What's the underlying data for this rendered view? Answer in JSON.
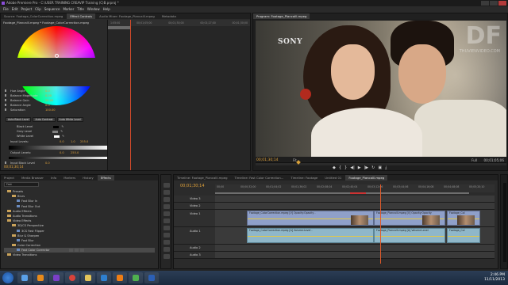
{
  "window": {
    "title": "Adobe Premiere Pro - C:\\USER TRAINING CREAVIP Training (C)B.prproj *"
  },
  "menu": [
    "File",
    "Edit",
    "Project",
    "Clip",
    "Sequence",
    "Marker",
    "Title",
    "Window",
    "Help"
  ],
  "effect_controls": {
    "tabs": [
      "Source: Footage_ColorCorrection.mpeg",
      "Effect Controls",
      "Audio Mixer: Footage_Plancalll.mpeg",
      "Metadata"
    ],
    "clip_path": "Footage_Plancalll.mpeg * Footage_ColorCorrection.mpeg",
    "ruler": [
      "1:05:00",
      "00;01;05;00",
      "00;01;30;00",
      "00;01;27;00",
      "00;01;30;00"
    ],
    "properties": [
      {
        "label": "Hue Angle",
        "value": "0.0"
      },
      {
        "label": "Balance Magnitude",
        "value": "0.00"
      },
      {
        "label": "Balance Gain",
        "value": "20.00"
      },
      {
        "label": "Balance Angle",
        "value": "0.0"
      },
      {
        "label": "Saturation",
        "value": "100.00"
      }
    ],
    "auto_buttons": [
      "Auto Black Level",
      "Auto Contrast",
      "Auto White Level"
    ],
    "levels": [
      "Black Level",
      "Gray Level",
      "White Level"
    ],
    "input_levels_label": "Input Levels:",
    "input_levels_values": [
      "0.0",
      "1.0",
      "255.0"
    ],
    "output_levels_label": "Output Levels:",
    "output_levels_values": [
      "0.0",
      "255.0"
    ],
    "more_props": [
      {
        "label": "Input Black Level",
        "value": "0.0"
      },
      {
        "label": "Input Gray Level",
        "value": "1.00"
      },
      {
        "label": "Input White Level",
        "value": "255.00"
      },
      {
        "label": "Output Black Level",
        "value": "0.00"
      }
    ],
    "timecode": "00;01;30;14"
  },
  "program_monitor": {
    "tab": "Program: Footage_Plancalll.mpeg",
    "brand": "SONY",
    "watermark": "DF",
    "watermark_sub": "THUVIENVIDEO.COM",
    "timecode": "00;01;30;14",
    "fit": "Fit",
    "full": "Full",
    "duration": "00;01;05;06",
    "transport_icons": [
      "marker-icon",
      "in-icon",
      "out-icon",
      "step-back-icon",
      "play-icon",
      "step-forward-icon",
      "loop-icon",
      "safe-icon",
      "export-icon"
    ]
  },
  "effects_panel": {
    "tabs": [
      "Project",
      "Media Browser",
      "Info",
      "Markers",
      "History",
      "Effects"
    ],
    "search": "Fast",
    "items": [
      {
        "label": "Presets",
        "kind": "folder",
        "indent": 0
      },
      {
        "label": "Blurs",
        "kind": "folder",
        "indent": 1
      },
      {
        "label": "Fast Blur In",
        "kind": "effect",
        "indent": 2
      },
      {
        "label": "Fast Blur Out",
        "kind": "effect",
        "indent": 2
      },
      {
        "label": "Audio Effects",
        "kind": "folder",
        "indent": 0
      },
      {
        "label": "Audio Transitions",
        "kind": "folder",
        "indent": 0
      },
      {
        "label": "Video Effects",
        "kind": "folder",
        "indent": 0
      },
      {
        "label": "3D/CS Perspective",
        "kind": "folder",
        "indent": 1
      },
      {
        "label": "3CS Fast Flipper",
        "kind": "effect",
        "indent": 2
      },
      {
        "label": "Blur & Sharpen",
        "kind": "folder",
        "indent": 1
      },
      {
        "label": "Fast Blur",
        "kind": "effect",
        "indent": 2
      },
      {
        "label": "Color Correction",
        "kind": "folder",
        "indent": 1
      },
      {
        "label": "Fast Color Corrector",
        "kind": "effect",
        "indent": 2,
        "selected": true
      },
      {
        "label": "Video Transitions",
        "kind": "folder",
        "indent": 0
      }
    ]
  },
  "timeline": {
    "tabs": [
      "Timeline: Footage_Plancalll.mpeg",
      "Timeline: Fast Color Correction...",
      "Timeline: Footage",
      "Untitled 01",
      "Footage_Plancalll.mpeg"
    ],
    "timecode": "00;01;30;14",
    "ruler": [
      "00;00",
      "00;00;32;00",
      "00;01;04;02",
      "00;01;36;02",
      "00;02;08;04",
      "00;02;40;04",
      "00;03;12;06",
      "00;03;44;06",
      "00;04;16;08",
      "00;04;48;08",
      "00;05;20;10"
    ],
    "tracks": [
      {
        "name": "Video 3",
        "type": "video"
      },
      {
        "name": "Video 2",
        "type": "video"
      },
      {
        "name": "Video 1",
        "type": "video-tall"
      },
      {
        "name": "Audio 1",
        "type": "audio-tall"
      },
      {
        "name": "Audio 2",
        "type": "audio"
      },
      {
        "name": "Audio 3",
        "type": "audio"
      }
    ],
    "clip_labels": {
      "v1a": "Footage_ColorCorrection.mpeg [V] Opacity:Opacity -",
      "v1b": "Footage_Plancalll.mpeg [V] Opacity:Opacity",
      "v1c": "Footage_Col",
      "a1a": "Footage_ColorCorrection.mpeg [A] Volume:Level -",
      "a1b": "Footage_Plancalll.mpeg [A] Volume:Level",
      "a1c": "Footage_Col"
    }
  },
  "taskbar": {
    "time": "2:46 PM",
    "date": "11/11/2013",
    "apps": [
      "explorer-icon",
      "media-player-icon",
      "premiere-icon",
      "chrome-icon",
      "folder-icon",
      "photoshop-icon",
      "vlc-icon",
      "paint-icon",
      "word-icon"
    ]
  }
}
